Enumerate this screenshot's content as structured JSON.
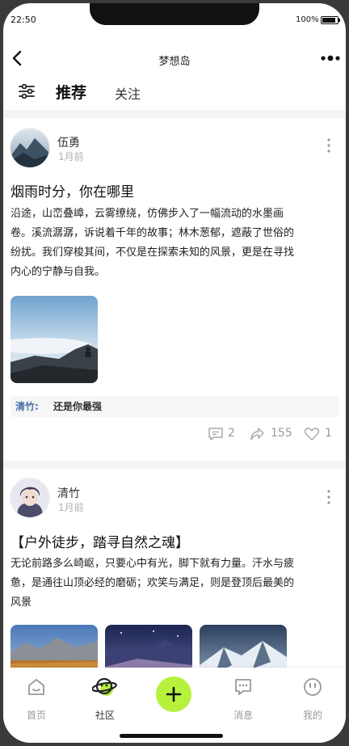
{
  "status_bar": {
    "time": "22:50",
    "battery": "100%"
  },
  "nav": {
    "title": "梦想岛"
  },
  "tabs": [
    {
      "label": "推荐"
    },
    {
      "label": "关注"
    }
  ],
  "posts": [
    {
      "user": "伍勇",
      "time": "1月前",
      "title": "烟雨时分，你在哪里",
      "body_lines": [
        "沿途，山峦叠嶂，云雾缭绕，仿佛步入了一幅流动的水墨画",
        "卷。溪流潺潺，诉说着千年的故事；林木葱郁，遮蔽了世俗的",
        "纷扰。我们穿梭其间，不仅是在探索未知的风景，更是在寻找",
        "内心的宁静与自我。"
      ],
      "comment": {
        "user": "清竹:",
        "text": "还是你最强"
      },
      "stats": {
        "comments": "2",
        "shares": "155",
        "likes": "1"
      }
    },
    {
      "user": "清竹",
      "time": "1月前",
      "title": "【户外徒步，踏寻自然之魂】",
      "body_lines": [
        "无论前路多么崎岖，只要心中有光，脚下就有力量。汗水与疲",
        "惫，是通往山顶必经的磨砺；欢笑与满足，则是登顶后最美的",
        "风景"
      ]
    }
  ],
  "tabbar": [
    {
      "label": "首页",
      "icon": "home-icon"
    },
    {
      "label": "社区",
      "icon": "planet-icon"
    },
    {
      "label": "",
      "icon": "add-icon"
    },
    {
      "label": "消息",
      "icon": "message-icon"
    },
    {
      "label": "我的",
      "icon": "face-icon"
    }
  ],
  "colors": {
    "accent": "#b6f23c",
    "comment_user": "#4a6fa5",
    "muted": "#999999"
  }
}
